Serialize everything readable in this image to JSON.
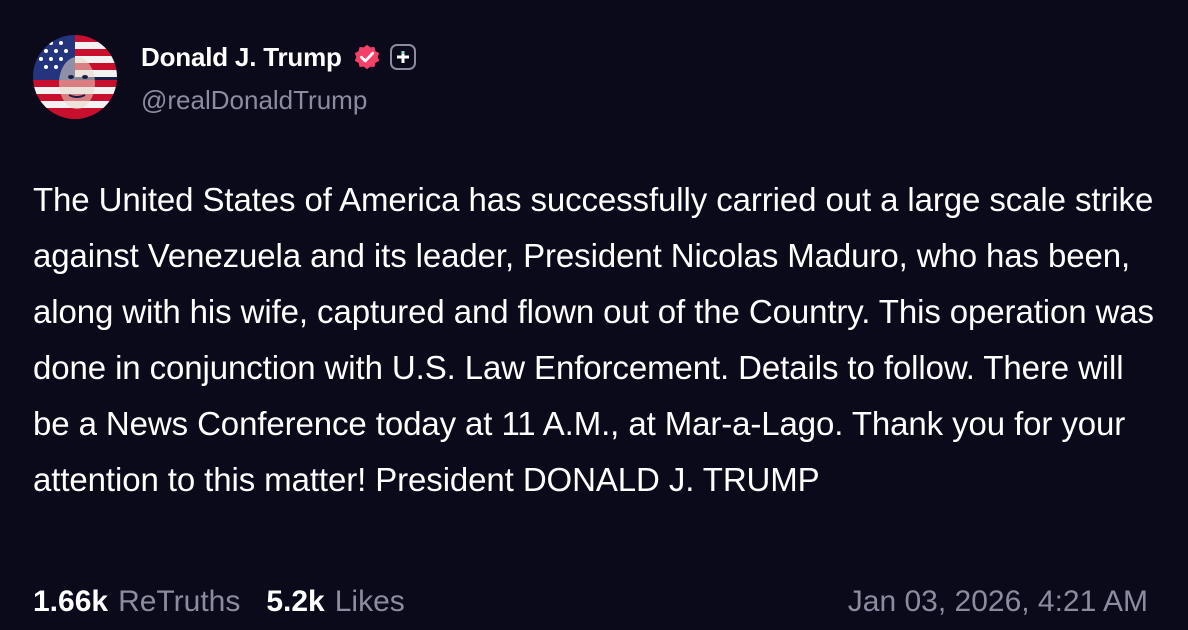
{
  "author": {
    "display_name": "Donald J. Trump",
    "handle": "@realDonaldTrump",
    "verified_icon": "verified-badge-icon",
    "subscribe_icon": "plus-icon"
  },
  "post": {
    "text": "The United States of America has successfully carried out a large scale strike against Venezuela and its leader, President Nicolas Maduro, who has been, along with his wife, captured and flown out of the Country. This operation was done in conjunction with U.S. Law Enforcement. Details to follow. There will be a News Conference today at 11 A.M., at Mar-a-Lago. Thank you for your attention to this matter! President DONALD J. TRUMP"
  },
  "stats": {
    "retruths_count": "1.66k",
    "retruths_label": "ReTruths",
    "likes_count": "5.2k",
    "likes_label": "Likes"
  },
  "timestamp": "Jan 03, 2026, 4:21 AM",
  "colors": {
    "background": "#0b0a1a",
    "muted_text": "#8c8ba0",
    "verified_badge": "#f5406a"
  }
}
